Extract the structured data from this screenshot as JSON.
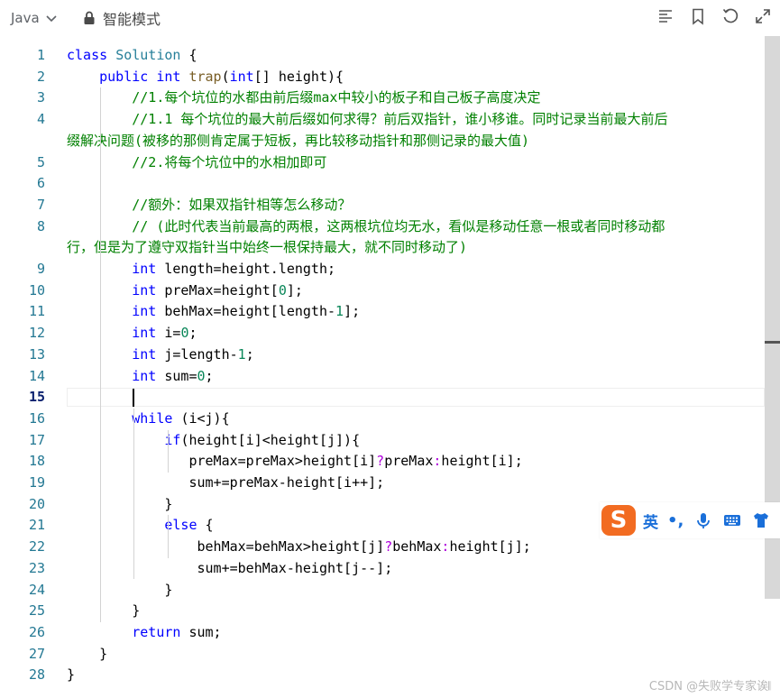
{
  "toolbar": {
    "language": "Java",
    "mode": "智能模式",
    "icons": [
      "list-icon",
      "bookmark-icon",
      "undo-icon",
      "expand-icon"
    ]
  },
  "editor": {
    "active_line": 15,
    "lines": [
      {
        "n": "1",
        "tokens": [
          [
            "k",
            "class "
          ],
          [
            "t",
            "Solution"
          ],
          [
            "o",
            " {"
          ]
        ]
      },
      {
        "n": "2",
        "tokens": [
          [
            "o",
            "    "
          ],
          [
            "k",
            "public "
          ],
          [
            "k",
            "int "
          ],
          [
            "f",
            "trap"
          ],
          [
            "o",
            "("
          ],
          [
            "k",
            "int"
          ],
          [
            "o",
            "[] "
          ],
          [
            "o",
            "height){"
          ]
        ]
      },
      {
        "n": "3",
        "tokens": [
          [
            "o",
            "        "
          ],
          [
            "c",
            "//1.每个坑位的水都由前后缀max中较小的板子和自己板子高度决定"
          ]
        ]
      },
      {
        "n": "4",
        "tokens": [
          [
            "o",
            "        "
          ],
          [
            "c",
            "//1.1 每个坑位的最大前后缀如何求得？前后双指针，谁小移谁。同时记录当前最大前后"
          ]
        ]
      },
      {
        "n": "",
        "tokens": [
          [
            "c",
            "缀解决问题(被移的那侧肯定属于短板，再比较移动指针和那侧记录的最大值)"
          ]
        ]
      },
      {
        "n": "5",
        "tokens": [
          [
            "o",
            "        "
          ],
          [
            "c",
            "//2.将每个坑位中的水相加即可"
          ]
        ]
      },
      {
        "n": "6",
        "tokens": []
      },
      {
        "n": "7",
        "tokens": [
          [
            "o",
            "        "
          ],
          [
            "c",
            "//额外：如果双指针相等怎么移动？"
          ]
        ]
      },
      {
        "n": "8",
        "tokens": [
          [
            "o",
            "        "
          ],
          [
            "c",
            "// (此时代表当前最高的两根，这两根坑位均无水，看似是移动任意一根或者同时移动都"
          ]
        ]
      },
      {
        "n": "",
        "tokens": [
          [
            "c",
            "行，但是为了遵守双指针当中始终一根保持最大，就不同时移动了)"
          ]
        ]
      },
      {
        "n": "9",
        "tokens": [
          [
            "o",
            "        "
          ],
          [
            "k",
            "int "
          ],
          [
            "o",
            "length=height.length;"
          ]
        ]
      },
      {
        "n": "10",
        "tokens": [
          [
            "o",
            "        "
          ],
          [
            "k",
            "int "
          ],
          [
            "o",
            "preMax=height["
          ],
          [
            "n",
            "0"
          ],
          [
            "o",
            "];"
          ]
        ]
      },
      {
        "n": "11",
        "tokens": [
          [
            "o",
            "        "
          ],
          [
            "k",
            "int "
          ],
          [
            "o",
            "behMax=height[length-"
          ],
          [
            "n",
            "1"
          ],
          [
            "o",
            "];"
          ]
        ]
      },
      {
        "n": "12",
        "tokens": [
          [
            "o",
            "        "
          ],
          [
            "k",
            "int "
          ],
          [
            "o",
            "i="
          ],
          [
            "n",
            "0"
          ],
          [
            "o",
            ";"
          ]
        ]
      },
      {
        "n": "13",
        "tokens": [
          [
            "o",
            "        "
          ],
          [
            "k",
            "int "
          ],
          [
            "o",
            "j=length-"
          ],
          [
            "n",
            "1"
          ],
          [
            "o",
            ";"
          ]
        ]
      },
      {
        "n": "14",
        "tokens": [
          [
            "o",
            "        "
          ],
          [
            "k",
            "int "
          ],
          [
            "o",
            "sum="
          ],
          [
            "n",
            "0"
          ],
          [
            "o",
            ";"
          ]
        ]
      },
      {
        "n": "15",
        "tokens": []
      },
      {
        "n": "16",
        "tokens": [
          [
            "o",
            "        "
          ],
          [
            "k",
            "while "
          ],
          [
            "o",
            "(i<j){"
          ]
        ]
      },
      {
        "n": "17",
        "tokens": [
          [
            "o",
            "            "
          ],
          [
            "k",
            "if"
          ],
          [
            "o",
            "(height[i]<height[j]){"
          ]
        ]
      },
      {
        "n": "18",
        "tokens": [
          [
            "o",
            "               preMax=preMax>height[i]"
          ],
          [
            "q",
            "?"
          ],
          [
            "o",
            "preMax"
          ],
          [
            "q",
            ":"
          ],
          [
            "o",
            "height[i];"
          ]
        ]
      },
      {
        "n": "19",
        "tokens": [
          [
            "o",
            "               sum+=preMax-height[i++];"
          ]
        ]
      },
      {
        "n": "20",
        "tokens": [
          [
            "o",
            "            }"
          ]
        ]
      },
      {
        "n": "21",
        "tokens": [
          [
            "o",
            "            "
          ],
          [
            "k",
            "else "
          ],
          [
            "o",
            "{"
          ]
        ]
      },
      {
        "n": "22",
        "tokens": [
          [
            "o",
            "                behMax=behMax>height[j]"
          ],
          [
            "q",
            "?"
          ],
          [
            "o",
            "behMax"
          ],
          [
            "q",
            ":"
          ],
          [
            "o",
            "height[j];"
          ]
        ]
      },
      {
        "n": "23",
        "tokens": [
          [
            "o",
            "                sum+=behMax-height[j--];"
          ]
        ]
      },
      {
        "n": "24",
        "tokens": [
          [
            "o",
            "            }"
          ]
        ]
      },
      {
        "n": "25",
        "tokens": [
          [
            "o",
            "        }"
          ]
        ]
      },
      {
        "n": "26",
        "tokens": [
          [
            "o",
            "        "
          ],
          [
            "k",
            "return "
          ],
          [
            "o",
            "sum;"
          ]
        ]
      },
      {
        "n": "27",
        "tokens": [
          [
            "o",
            "    }"
          ]
        ]
      },
      {
        "n": "28",
        "tokens": [
          [
            "o",
            "}"
          ]
        ]
      }
    ]
  },
  "ime": {
    "logo": "S",
    "language_label": "英",
    "punct_label": "•,",
    "icons": [
      "microphone-icon",
      "keyboard-icon",
      "skin-icon"
    ]
  },
  "watermark": "CSDN @失败学专家诶𝄃",
  "colors": {
    "keyword": "#0000ff",
    "type": "#267f99",
    "function": "#795e26",
    "comment": "#008000",
    "number": "#098658",
    "line_number": "#237893",
    "ime_orange": "#f26b21",
    "ime_blue": "#1a6fd9"
  }
}
